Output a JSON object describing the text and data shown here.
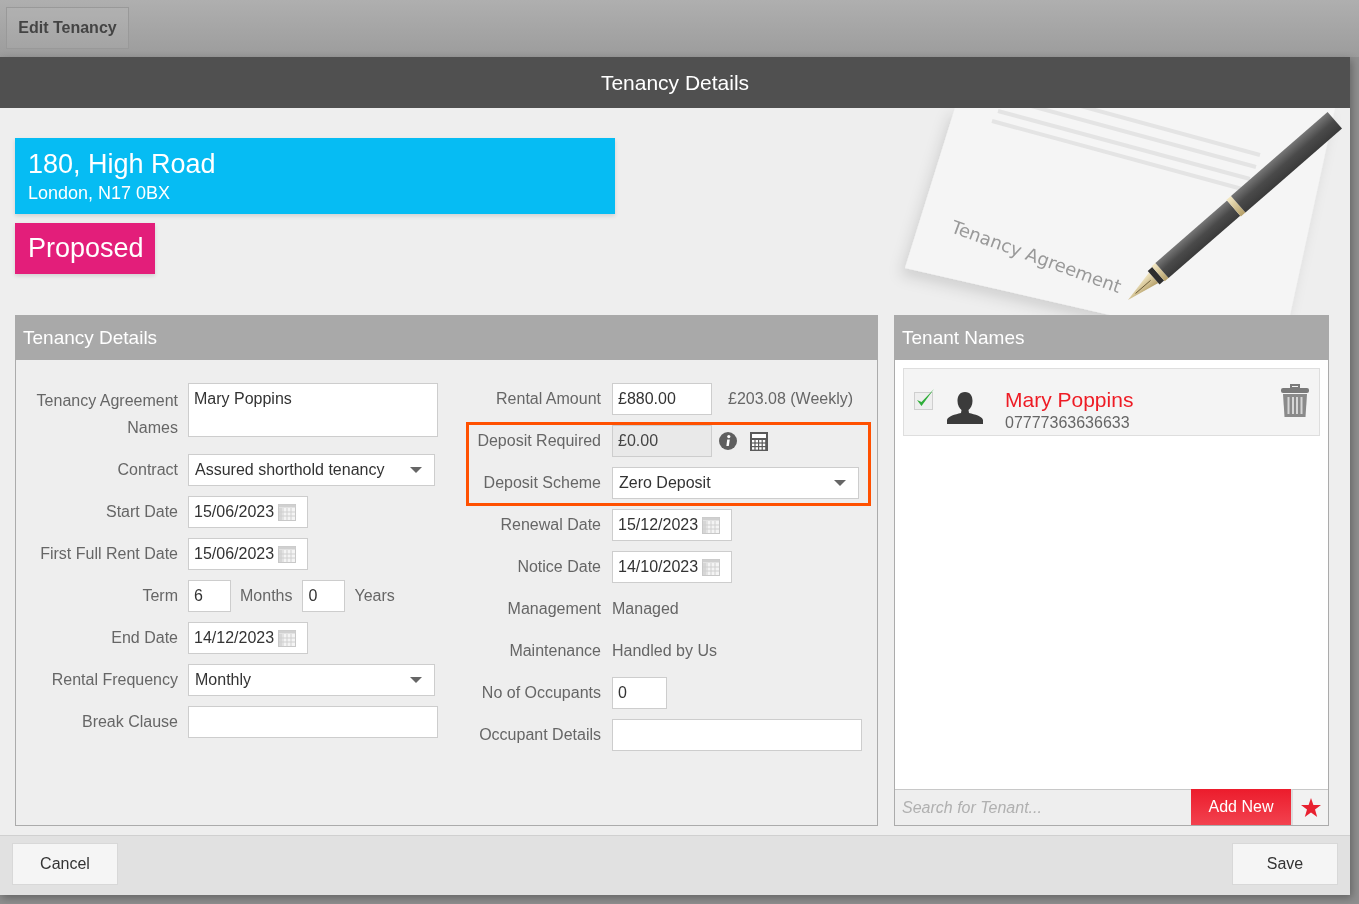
{
  "top_bar": {
    "button": "Edit Tenancy"
  },
  "dialog": {
    "title": "Tenancy Details"
  },
  "property": {
    "address_line_1": "180, High Road",
    "address_line_2": "London, N17 0BX",
    "status": "Proposed"
  },
  "illustration": {
    "document_title": "Tenancy Agreement"
  },
  "tenancy_panel": {
    "title": "Tenancy Details",
    "left_fields": [
      {
        "kind": "textarea",
        "label": "Tenancy Agreement Names",
        "value": "Mary Poppins"
      },
      {
        "kind": "select",
        "label": "Contract",
        "value": "Assured shorthold tenancy"
      },
      {
        "kind": "date",
        "label": "Start Date",
        "value": "15/06/2023"
      },
      {
        "kind": "date",
        "label": "First Full Rent Date",
        "value": "15/06/2023"
      },
      {
        "kind": "term",
        "label": "Term",
        "months": "6",
        "months_unit": "Months",
        "years": "0",
        "years_unit": "Years"
      },
      {
        "kind": "date",
        "label": "End Date",
        "value": "14/12/2023"
      },
      {
        "kind": "select",
        "label": "Rental Frequency",
        "value": "Monthly"
      },
      {
        "kind": "input",
        "label": "Break Clause"
      }
    ],
    "right_fields": [
      {
        "kind": "money",
        "label": "Rental Amount",
        "value": "£880.00",
        "note": "£203.08 (Weekly)",
        "disabled": false,
        "highlighted": false
      },
      {
        "kind": "calculated",
        "label": "Deposit Required",
        "value": "£0.00",
        "disabled": true,
        "highlighted": true
      },
      {
        "kind": "select",
        "label": "Deposit Scheme",
        "value": "Zero Deposit",
        "disabled": false,
        "highlighted": true
      },
      {
        "kind": "date",
        "label": "Renewal Date",
        "value": "15/12/2023",
        "disabled": false,
        "highlighted": false
      },
      {
        "kind": "date",
        "label": "Notice Date",
        "value": "14/10/2023",
        "disabled": false,
        "highlighted": false
      },
      {
        "kind": "static",
        "label": "Management",
        "value": "Managed",
        "disabled": false,
        "highlighted": false
      },
      {
        "kind": "static",
        "label": "Maintenance",
        "value": "Handled by Us",
        "disabled": false,
        "highlighted": false
      },
      {
        "kind": "number",
        "label": "No of Occupants",
        "value": "0",
        "disabled": false,
        "highlighted": false
      },
      {
        "kind": "input",
        "label": "Occupant Details",
        "disabled": false,
        "highlighted": false
      }
    ]
  },
  "tenant_panel": {
    "title": "Tenant Names",
    "tenants": [
      {
        "name": "Mary Poppins",
        "phone": "07777363636633",
        "checked": true
      }
    ],
    "search": {
      "placeholder": "Search for Tenant..."
    },
    "add_button": "Add New"
  },
  "footer": {
    "cancel_button": "Cancel",
    "save_button": "Save"
  }
}
